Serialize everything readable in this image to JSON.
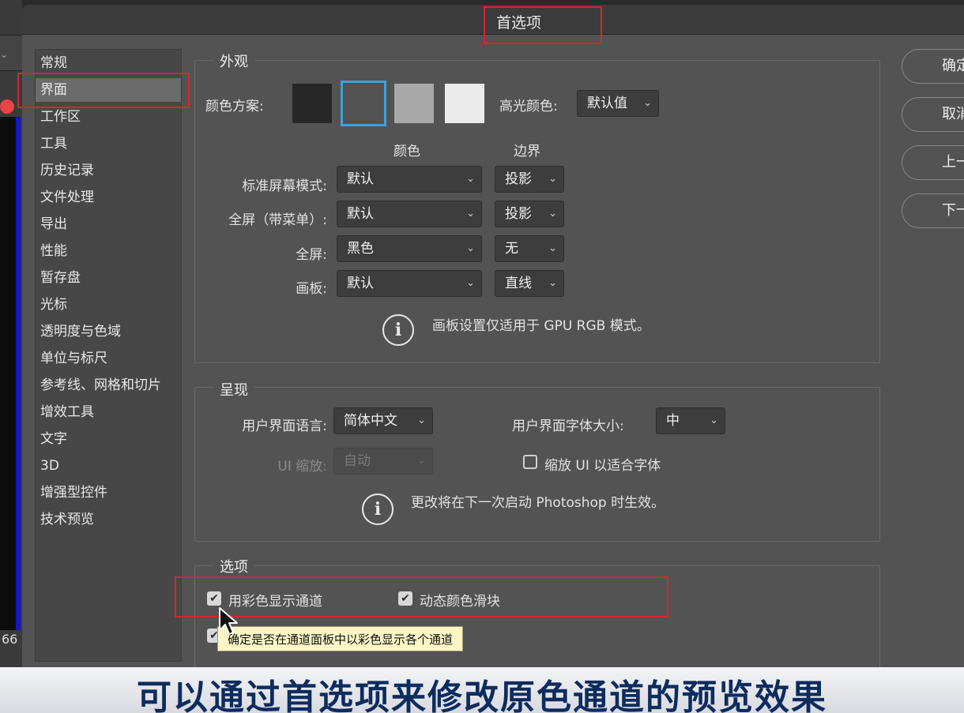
{
  "dialog": {
    "title": "首选项"
  },
  "background": {
    "zoom_text": "66"
  },
  "nav": {
    "items": [
      {
        "label": "常规"
      },
      {
        "label": "界面"
      },
      {
        "label": "工作区"
      },
      {
        "label": "工具"
      },
      {
        "label": "历史记录"
      },
      {
        "label": "文件处理"
      },
      {
        "label": "导出"
      },
      {
        "label": "性能"
      },
      {
        "label": "暂存盘"
      },
      {
        "label": "光标"
      },
      {
        "label": "透明度与色域"
      },
      {
        "label": "单位与标尺"
      },
      {
        "label": "参考线、网格和切片"
      },
      {
        "label": "增效工具"
      },
      {
        "label": "文字"
      },
      {
        "label": "3D"
      },
      {
        "label": "增强型控件"
      },
      {
        "label": "技术预览"
      }
    ],
    "selected": "界面"
  },
  "appearance": {
    "group_label": "外观",
    "color_scheme_label": "颜色方案:",
    "swatches": [
      {
        "color": "#272727",
        "selected": false
      },
      {
        "color": "#525252",
        "selected": true
      },
      {
        "color": "#a8a8a8",
        "selected": false
      },
      {
        "color": "#ebebeb",
        "selected": false
      }
    ],
    "highlight_label": "高光颜色:",
    "highlight_value": "默认值",
    "col_color": "颜色",
    "col_border": "边界",
    "rows": [
      {
        "label": "标准屏幕模式:",
        "color": "默认",
        "border": "投影"
      },
      {
        "label": "全屏（带菜单）:",
        "color": "默认",
        "border": "投影"
      },
      {
        "label": "全屏:",
        "color": "黑色",
        "border": "无"
      },
      {
        "label": "画板:",
        "color": "默认",
        "border": "直线"
      }
    ],
    "note": "画板设置仅适用于 GPU RGB 模式。"
  },
  "presentation": {
    "group_label": "呈现",
    "ui_language_label": "用户界面语言:",
    "ui_language_value": "简体中文",
    "ui_font_size_label": "用户界面字体大小:",
    "ui_font_size_value": "中",
    "ui_scale_label": "UI 缩放:",
    "ui_scale_value": "自动",
    "scale_to_font_label": "缩放 UI 以适合字体",
    "scale_to_font_checked": false,
    "note": "更改将在下一次启动 Photoshop 时生效。"
  },
  "options": {
    "group_label": "选项",
    "show_channels_color_label": "用彩色显示通道",
    "show_channels_color_checked": true,
    "dynamic_sliders_label": "动态颜色滑块",
    "dynamic_sliders_checked": true,
    "third_checked": true,
    "tooltip": "确定是否在通道面板中以彩色显示各个通道"
  },
  "buttons": {
    "ok": "确定",
    "cancel": "取消",
    "prev": "上一个",
    "next": "下一个"
  },
  "caption": "可以通过首选项来修改原色通道的预览效果",
  "colors": {
    "dialog_bg": "#535353",
    "accent_blue": "#3aa2e0",
    "annotation_red": "#d9262b",
    "caption_text": "#0d2c5e"
  }
}
